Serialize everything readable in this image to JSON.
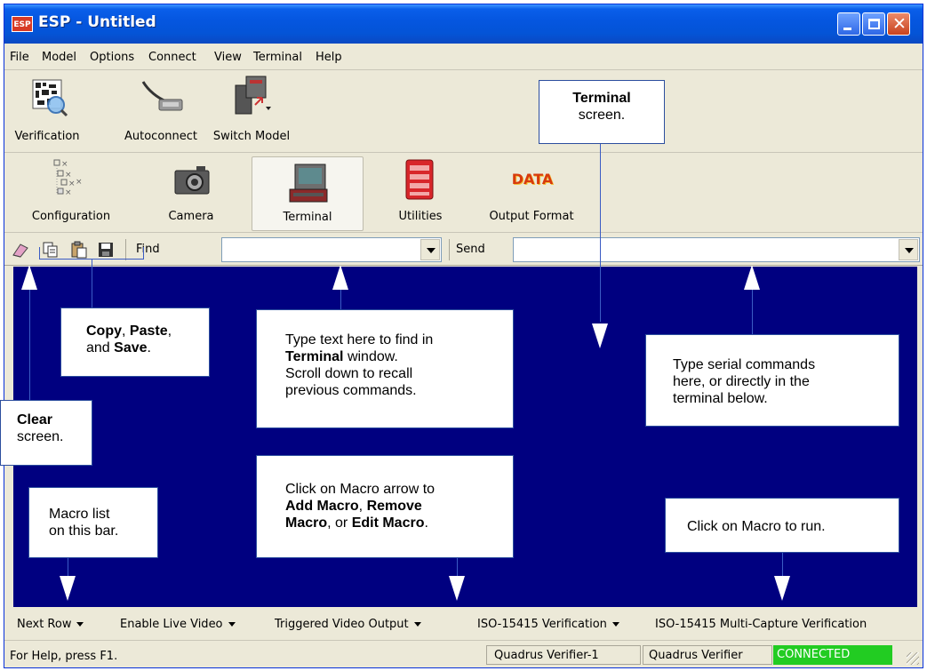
{
  "window": {
    "title": "ESP - Untitled",
    "icon_text": "ESP"
  },
  "menu": [
    "File",
    "Model",
    "Options",
    "Connect",
    "View",
    "Terminal",
    "Help"
  ],
  "toolbar_top": [
    {
      "label": "Verification",
      "icon": "verification-icon"
    },
    {
      "label": "Autoconnect",
      "icon": "autoconnect-cable-icon"
    },
    {
      "label": "Switch Model",
      "icon": "switch-model-icon"
    }
  ],
  "toolbar_modes": [
    {
      "label": "Configuration",
      "icon": "configuration-tree-icon"
    },
    {
      "label": "Camera",
      "icon": "camera-icon"
    },
    {
      "label": "Terminal",
      "icon": "terminal-icon",
      "active": true
    },
    {
      "label": "Utilities",
      "icon": "utilities-icon"
    },
    {
      "label": "Output Format",
      "icon": "output-format-icon",
      "icon_text": "DATA"
    }
  ],
  "findbar": {
    "find_label": "Find",
    "find_value": "",
    "send_label": "Send",
    "send_value": "",
    "icons": [
      "eraser-icon",
      "copy-icon",
      "paste-icon",
      "save-icon"
    ]
  },
  "macros": [
    "Next Row",
    "Enable Live Video",
    "Triggered Video Output",
    "ISO-15415 Verification",
    "ISO-15415 Multi-Capture Verification"
  ],
  "status": {
    "help": "For Help, press F1.",
    "device": "Quadrus Verifier-1",
    "model": "Quadrus Verifier",
    "connection": "CONNECTED"
  },
  "colors": {
    "terminal_bg": "#000080",
    "connected": "#22CC22",
    "titlebar": "#0454D6"
  },
  "annotations": {
    "terminal_bold": "Terminal",
    "terminal_rest": "screen.",
    "copy_bold": "Copy",
    "copy_sep1": ", ",
    "paste_bold": "Paste",
    "copy_sep2": ",",
    "copy_and": "and ",
    "save_bold": "Save",
    "copy_end": ".",
    "find_line1": "Type text here to find in",
    "find_bold": "Terminal",
    "find_line2_rest": " window.",
    "find_line3": "Scroll down to recall",
    "find_line4": "previous commands.",
    "send_line1": "Type serial commands",
    "send_line2": "here, or directly in the",
    "send_line3": "terminal below.",
    "clear_bold": "Clear",
    "clear_rest": "screen.",
    "macro_list_line1": "Macro list",
    "macro_list_line2": "on this bar.",
    "macro_arrow_line1": "Click on Macro arrow to",
    "add_macro_bold": "Add Macro",
    "sep_comma": ", ",
    "remove_bold": "Remove",
    "macro_bold": "Macro",
    "or_text": ", or ",
    "edit_macro_bold": "Edit Macro",
    "period": ".",
    "run_text": "Click on Macro to run."
  }
}
